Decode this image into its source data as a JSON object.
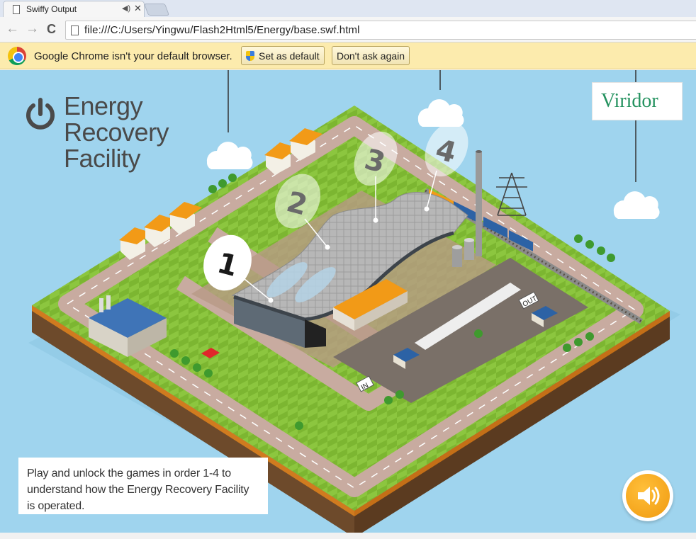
{
  "browser": {
    "tab_title": "Swiffy Output",
    "tab_close": "✕",
    "tab_audio": "◀)",
    "back": "←",
    "forward": "→",
    "reload": "C",
    "url": "file:///C:/Users/Yingwu/Flash2Html5/Energy/base.swf.html"
  },
  "infobar": {
    "message": "Google Chrome isn't your default browser.",
    "set_default_label": "Set as default",
    "dont_ask_label": "Don't ask again"
  },
  "page": {
    "title_line1": "Energy",
    "title_line2": "Recovery",
    "title_line3": "Facility",
    "partner_logo": "Viridor",
    "instruction": "Play and unlock the games in order 1-4 to understand how the Energy Recovery Facility is operated.",
    "steps": [
      {
        "label": "1"
      },
      {
        "label": "2"
      },
      {
        "label": "3"
      },
      {
        "label": "4"
      }
    ],
    "sign_in": "IN",
    "sign_out": "OUT",
    "colors": {
      "sky": "#9fd4ee",
      "grass": "#8cc63f",
      "road": "#c8aba0",
      "accent_orange": "#f29a17",
      "viridor_green": "#24925f"
    },
    "icons": {
      "power": "power-icon",
      "sound": "speaker-icon"
    }
  }
}
